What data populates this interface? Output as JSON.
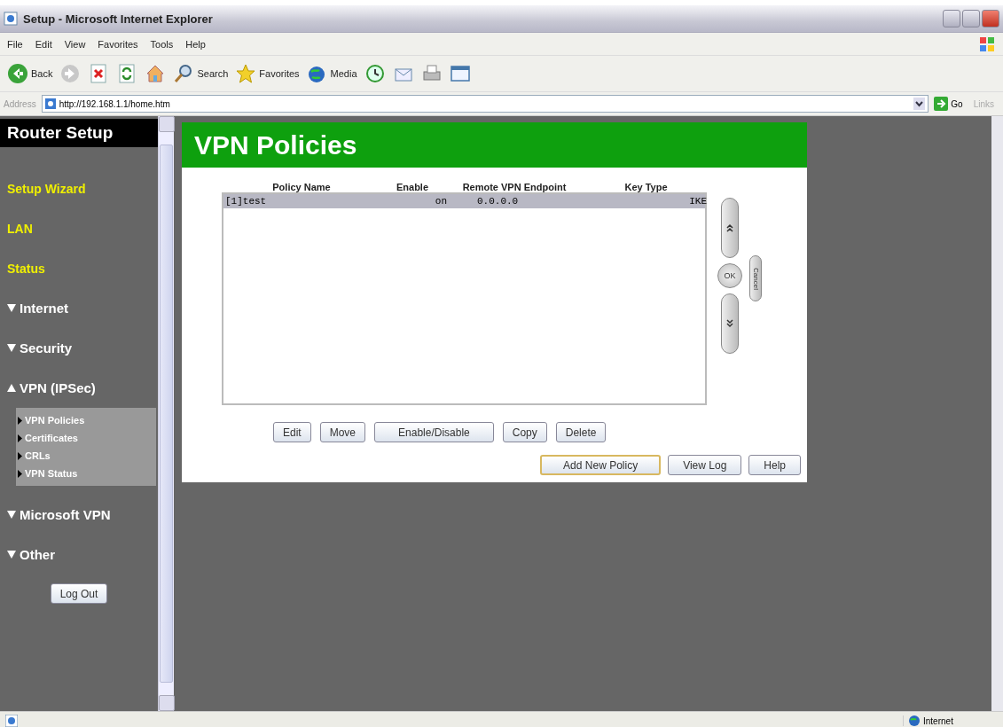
{
  "window": {
    "title": "Setup - Microsoft Internet Explorer"
  },
  "menu": [
    "File",
    "Edit",
    "View",
    "Favorites",
    "Tools",
    "Help"
  ],
  "toolbar": [
    {
      "kind": "back",
      "label": "Back"
    },
    {
      "kind": "forward"
    },
    {
      "kind": "stop"
    },
    {
      "kind": "refresh"
    },
    {
      "kind": "home"
    },
    {
      "kind": "search",
      "label": "Search"
    },
    {
      "kind": "favorites",
      "label": "Favorites"
    },
    {
      "kind": "media",
      "label": "Media"
    },
    {
      "kind": "history"
    },
    {
      "kind": "mail"
    },
    {
      "kind": "print"
    },
    {
      "kind": "edit"
    }
  ],
  "address_bar": {
    "label": "Address",
    "url": "http://192.168.1.1/home.htm",
    "go": "Go",
    "links": "Links"
  },
  "sidebar": {
    "title": "Router Setup",
    "items": [
      {
        "label": "Setup Wizard",
        "kind": "link"
      },
      {
        "label": "LAN",
        "kind": "link"
      },
      {
        "label": "Status",
        "kind": "link"
      },
      {
        "label": "Internet",
        "kind": "section",
        "expanded": false
      },
      {
        "label": "Security",
        "kind": "section",
        "expanded": false
      },
      {
        "label": "VPN (IPSec)",
        "kind": "section",
        "expanded": true,
        "children": [
          {
            "label": "VPN Policies"
          },
          {
            "label": "Certificates"
          },
          {
            "label": "CRLs"
          },
          {
            "label": "VPN Status"
          }
        ]
      },
      {
        "label": "Microsoft VPN",
        "kind": "section",
        "expanded": false
      },
      {
        "label": "Other",
        "kind": "section",
        "expanded": false
      }
    ],
    "logout": "Log Out"
  },
  "page": {
    "title": "VPN Policies",
    "table": {
      "columns": [
        "Policy Name",
        "Enable",
        "Remote VPN Endpoint",
        "Key Type"
      ],
      "rows": [
        {
          "cells": [
            "[1]test",
            "on",
            "0.0.0.0",
            "IKE"
          ],
          "selected": true
        }
      ]
    },
    "ok": "OK",
    "cancel": "Cancel",
    "actions": [
      "Edit",
      "Move",
      "Enable/Disable",
      "Copy",
      "Delete"
    ],
    "footer_buttons": [
      {
        "label": "Add New Policy",
        "default": true
      },
      {
        "label": "View Log",
        "default": false
      },
      {
        "label": "Help",
        "default": false
      }
    ]
  },
  "status_bar": {
    "zone": "Internet"
  }
}
